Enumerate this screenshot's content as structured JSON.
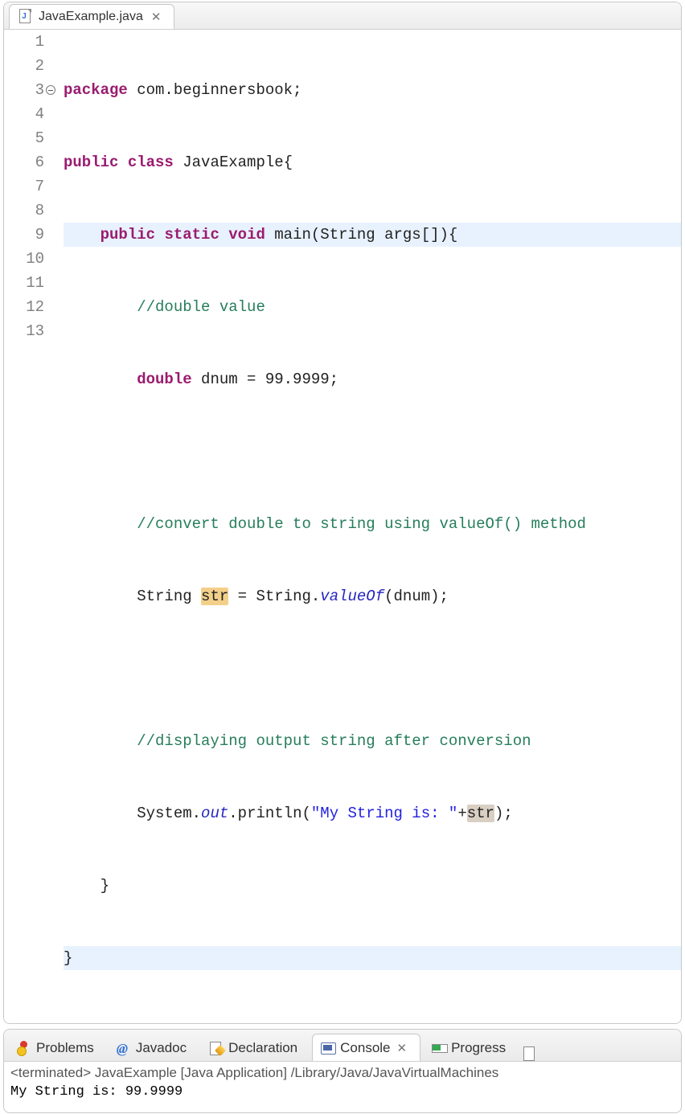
{
  "editor": {
    "tab": {
      "filename": "JavaExample.java"
    },
    "line_numbers": [
      "1",
      "2",
      "3",
      "4",
      "5",
      "6",
      "7",
      "8",
      "9",
      "10",
      "11",
      "12",
      "13"
    ],
    "foldable_line_index": 2,
    "code": {
      "l1": {
        "kw1": "package",
        "rest": " com.beginnersbook;"
      },
      "l2": {
        "kw1": "public",
        "kw2": "class",
        "name": " JavaExample{"
      },
      "l3": {
        "kw1": "public",
        "kw2": "static",
        "kw3": "void",
        "sig": " main(String args[]){"
      },
      "l4": {
        "comment": "//double value"
      },
      "l5": {
        "kw": "double",
        "rest1": " dnum = 99.9999;"
      },
      "l6": "",
      "l7": {
        "comment": "//convert double to string using valueOf() method"
      },
      "l8": {
        "pre": "String ",
        "mark": "str",
        "mid": " = String.",
        "ital": "valueOf",
        "post": "(dnum);"
      },
      "l9": "",
      "l10": {
        "comment": "//displaying output string after conversion"
      },
      "l11": {
        "pre": "System.",
        "ital": "out",
        "mid": ".println(",
        "strlit": "\"My String is: \"",
        "plus": "+",
        "mark": "str",
        "post": ");"
      },
      "l12": "    }",
      "l13": "}"
    }
  },
  "bottom": {
    "tabs": {
      "problems": "Problems",
      "javadoc": "Javadoc",
      "declaration": "Declaration",
      "console": "Console",
      "progress": "Progress"
    },
    "active_tab": "console",
    "console": {
      "status": "<terminated> JavaExample [Java Application] /Library/Java/JavaVirtualMachines",
      "output": "My String is: 99.9999"
    }
  }
}
